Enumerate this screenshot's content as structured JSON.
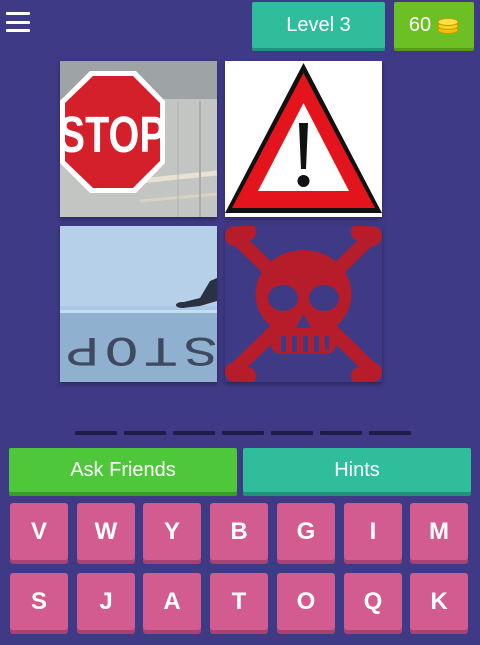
{
  "header": {
    "menu_icon": "hamburger-menu-icon",
    "level_label": "Level 3",
    "coins": "60",
    "coin_icon": "coin-stack-icon"
  },
  "puzzle": {
    "images": [
      {
        "icon": "stop-sign-photo"
      },
      {
        "icon": "warning-exclamation-triangle"
      },
      {
        "icon": "painted-stop-road-marking-photo"
      },
      {
        "icon": "skull-and-crossbones"
      }
    ],
    "photo_text": [
      "STOP",
      "STOP"
    ],
    "answer_slots": 7
  },
  "actions": {
    "ask_friends_label": "Ask Friends",
    "hints_label": "Hints"
  },
  "keyboard": {
    "row1": [
      "V",
      "W",
      "Y",
      "B",
      "G",
      "I",
      "M"
    ],
    "row2": [
      "S",
      "J",
      "A",
      "T",
      "O",
      "Q",
      "K"
    ]
  },
  "colors": {
    "background": "#3f3a85",
    "teal": "#2fbd9c",
    "green": "#6cc023",
    "ask_green": "#4ec73a",
    "key_pink": "#d25b8f",
    "sign_red": "#d4202a"
  }
}
